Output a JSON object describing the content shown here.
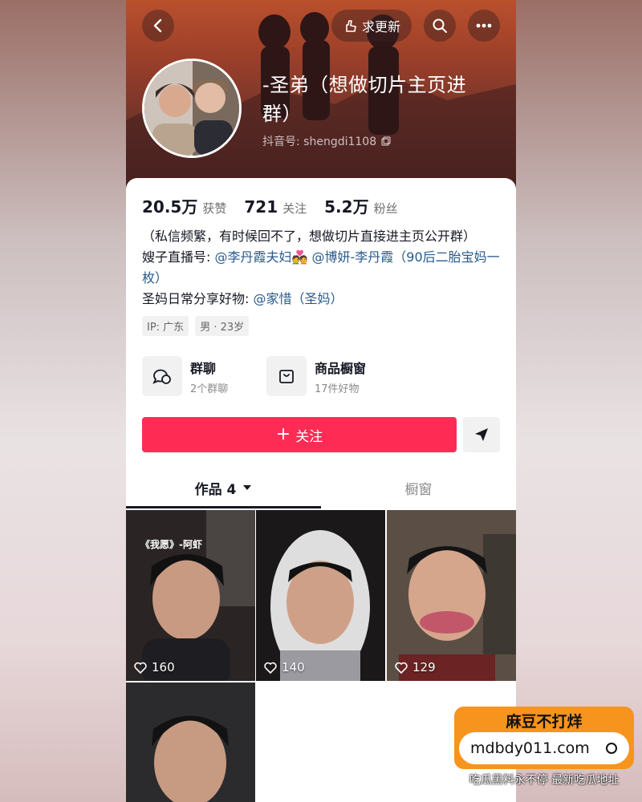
{
  "header": {
    "request_update_label": "求更新",
    "name": "-圣弟（想做切片主页进群）",
    "douyin_id": "抖音号: shengdi1108"
  },
  "stats": [
    {
      "value": "20.5万",
      "label": "获赞"
    },
    {
      "value": "721",
      "label": "关注"
    },
    {
      "value": "5.2万",
      "label": "粉丝"
    }
  ],
  "bio": {
    "line1": "（私信频繁，有时候回不了，想做切片直接进主页公开群）",
    "line2_prefix": "嫂子直播号: ",
    "line2_link1": "@李丹霞夫妇💑",
    "line2_link2": "@博妍-李丹霞（90后二胎宝妈一枚）",
    "line3_prefix": "圣妈日常分享好物: ",
    "line3_link": "@家惜（圣妈）"
  },
  "tags": [
    "IP: 广东",
    "男 · 23岁"
  ],
  "features": [
    {
      "title": "群聊",
      "sub": "2个群聊",
      "icon": "chat-bubbles-icon"
    },
    {
      "title": "商品橱窗",
      "sub": "17件好物",
      "icon": "shopping-bag-icon"
    }
  ],
  "follow_label": "关注",
  "tabs": {
    "works": "作品 4",
    "showcase": "橱窗"
  },
  "videos": [
    {
      "likes": "160",
      "caption": "《我愿》-阿虾"
    },
    {
      "likes": "140"
    },
    {
      "likes": "129"
    },
    {
      "likes": ""
    }
  ],
  "watermark": {
    "title": "麻豆不打烊",
    "url": "mdbdy011.com",
    "footer": "吃瓜黑料永不停  最新吃瓜地址"
  },
  "colors": {
    "follow": "#fe2c55",
    "watermark": "#f7941d",
    "link": "#2a5a8c"
  }
}
